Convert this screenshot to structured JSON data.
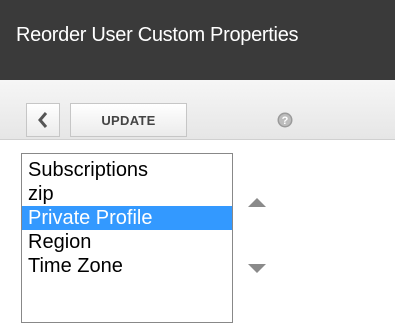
{
  "window": {
    "title": "Reorder User Custom Properties"
  },
  "toolbar": {
    "back_icon": "chevron-left-icon",
    "update_label": "UPDATE",
    "help_icon": "question-mark-icon"
  },
  "properties_list": {
    "items": [
      "Subscriptions",
      "zip",
      "Private Profile",
      "Region",
      "Time Zone"
    ],
    "selected": "Private Profile",
    "selected_color": "#3399ff"
  },
  "reorder_controls": {
    "up_icon": "triangle-up-icon",
    "down_icon": "triangle-down-icon"
  }
}
